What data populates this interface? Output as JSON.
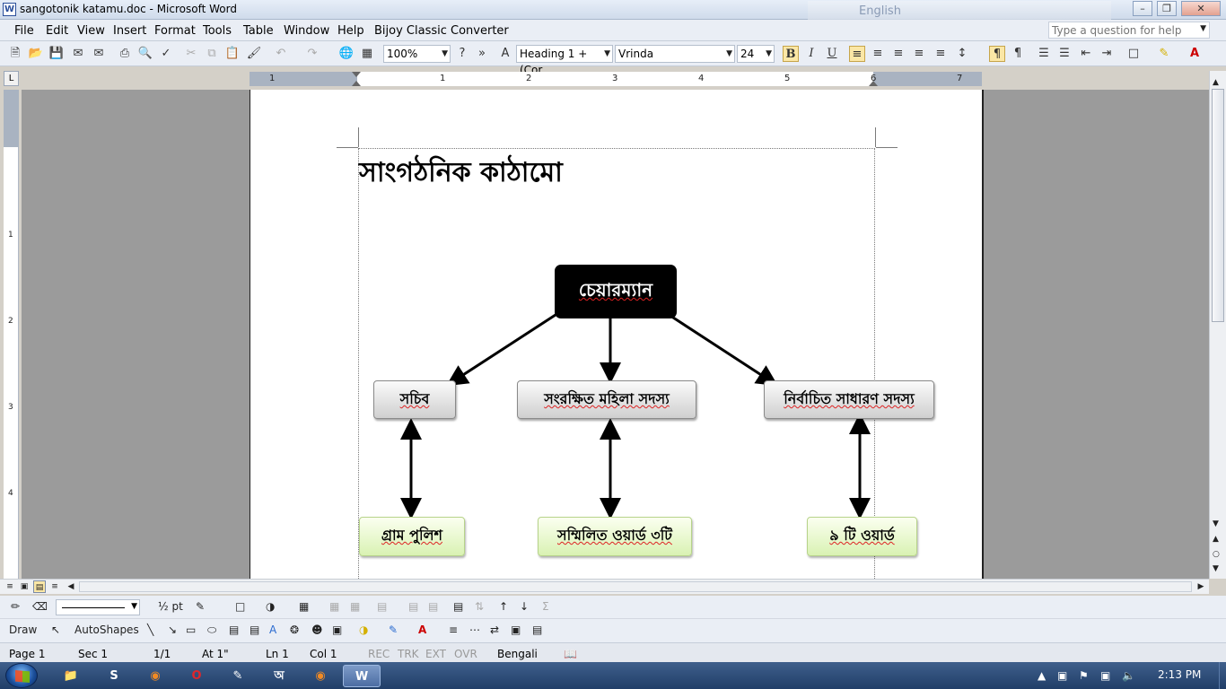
{
  "window": {
    "title": "sangotonik katamu.doc - Microsoft Word",
    "language_label": "English"
  },
  "menu": {
    "items": [
      "File",
      "Edit",
      "View",
      "Insert",
      "Format",
      "Tools",
      "Table",
      "Window",
      "Help",
      "Bijoy Classic Converter"
    ],
    "help_placeholder": "Type a question for help"
  },
  "toolbar": {
    "zoom": "100%",
    "style": "Heading 1 + (Cor",
    "font": "Vrinda",
    "size": "24",
    "bold": "B",
    "italic": "I",
    "underline": "U"
  },
  "ruler": {
    "h_numbers": [
      "1",
      "1",
      "2",
      "3",
      "4",
      "5",
      "6",
      "7"
    ],
    "v_numbers": [
      "1",
      "2",
      "3",
      "4"
    ]
  },
  "document": {
    "heading": "সাংগঠনিক কাঠামো",
    "diagram": {
      "top": "চেয়ারম্যান",
      "middle": [
        "সচিব",
        "সংরক্ষিত মহিলা সদস্য",
        "নির্বাচিত সাধারণ সদস্য"
      ],
      "bottom": [
        "গ্রাম পুলিশ",
        "সম্মিলিত ওয়ার্ড ৩টি",
        "৯ টি ওয়ার্ড"
      ]
    }
  },
  "drawing_toolbar": {
    "line_weight": "½ pt",
    "draw": "Draw",
    "autoshapes": "AutoShapes"
  },
  "status": {
    "page": "Page  1",
    "sec": "Sec  1",
    "pages": "1/1",
    "at": "At  1\"",
    "ln": "Ln  1",
    "col": "Col  1",
    "rec": "REC",
    "trk": "TRK",
    "ext": "EXT",
    "ovr": "OVR",
    "lang": "Bengali"
  },
  "taskbar": {
    "clock": "2:13 PM"
  },
  "colors": {
    "title_bar": "#cfdbeb",
    "menu_bg": "#eaeef5",
    "taskbar": "#2a4a78",
    "node_black": "#000000",
    "node_green": "#d9f2b3"
  }
}
